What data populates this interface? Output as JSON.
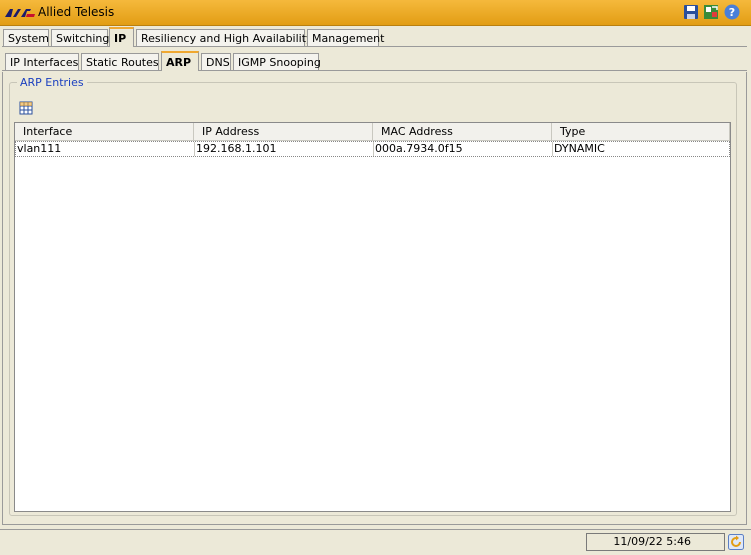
{
  "app": {
    "title": "Allied Telesis",
    "brand_color": "#e7a21f"
  },
  "toolbar_icons": [
    "save-icon",
    "export-icon",
    "help-icon"
  ],
  "main_tabs": [
    {
      "label": "System"
    },
    {
      "label": "Switching"
    },
    {
      "label": "IP",
      "active": true
    },
    {
      "label": "Resiliency and High Availability"
    },
    {
      "label": "Management"
    }
  ],
  "sub_tabs": [
    {
      "label": "IP Interfaces"
    },
    {
      "label": "Static Routes"
    },
    {
      "label": "ARP",
      "active": true
    },
    {
      "label": "DNS"
    },
    {
      "label": "IGMP Snooping"
    }
  ],
  "arp": {
    "section_title": "ARP Entries",
    "columns": [
      "Interface",
      "IP Address",
      "MAC Address",
      "Type"
    ],
    "rows": [
      [
        "vlan111",
        "192.168.1.101",
        "000a.7934.0f15",
        "DYNAMIC"
      ]
    ]
  },
  "status": {
    "datetime": "11/09/22 5:46"
  }
}
